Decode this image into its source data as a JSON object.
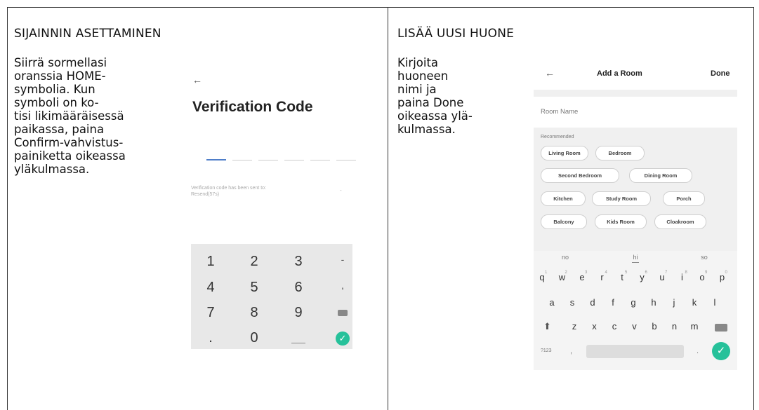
{
  "left_column": {
    "heading": "SIJAINNIN ASETTAMINEN",
    "instruction": "Siirrä sormellasi\noranssia HOME-\nsymbolia. Kun\nsymboli on ko-\ntisi likimääräisessä\npaikassa, paina\nConfirm-vahvistus-\npainiketta oikeassa\nyläkulmassa.",
    "phone": {
      "back_icon": "←",
      "title": "Verification Code",
      "code_slots": 6,
      "note": "Verification code has been sent to:\nResend(57s)",
      "note_dash": "-",
      "keypad": {
        "rows": [
          [
            "1",
            "2",
            "3",
            "-"
          ],
          [
            "4",
            "5",
            "6",
            ","
          ],
          [
            "7",
            "8",
            "9",
            "backspace-icon"
          ],
          [
            ".",
            "0",
            "space-icon",
            "confirm-icon"
          ]
        ],
        "confirm_glyph": "✓"
      }
    }
  },
  "right_column": {
    "heading": "LISÄÄ UUSI HUONE",
    "instruction": "Kirjoita\nhuoneen\nnimi ja\npaina Done\noikeassa ylä-\nkulmassa.",
    "phone": {
      "back_icon": "←",
      "title": "Add a Room",
      "done_label": "Done",
      "room_name_label": "Room Name",
      "recommended_label": "Recommended",
      "chips": [
        [
          "Living Room",
          "Bedroom"
        ],
        [
          "Second Bedroom",
          "Dining Room"
        ],
        [
          "Kitchen",
          "Study Room",
          "Porch"
        ],
        [
          "Balcony",
          "Kids Room",
          "Cloakroom"
        ]
      ],
      "keyboard": {
        "suggestions": [
          "no",
          "hi",
          "so"
        ],
        "row1": [
          "q",
          "w",
          "e",
          "r",
          "t",
          "y",
          "u",
          "i",
          "o",
          "p"
        ],
        "row1_numbers": [
          "1",
          "2",
          "3",
          "4",
          "5",
          "6",
          "7",
          "8",
          "9",
          "0"
        ],
        "row2": [
          "a",
          "s",
          "d",
          "f",
          "g",
          "h",
          "j",
          "k",
          "l"
        ],
        "row3": [
          "z",
          "x",
          "c",
          "v",
          "b",
          "n",
          "m"
        ],
        "symbols_key": "?123",
        "comma_key": ",",
        "period_key": ".",
        "confirm_glyph": "✓",
        "shift_glyph": "⬆"
      }
    }
  }
}
